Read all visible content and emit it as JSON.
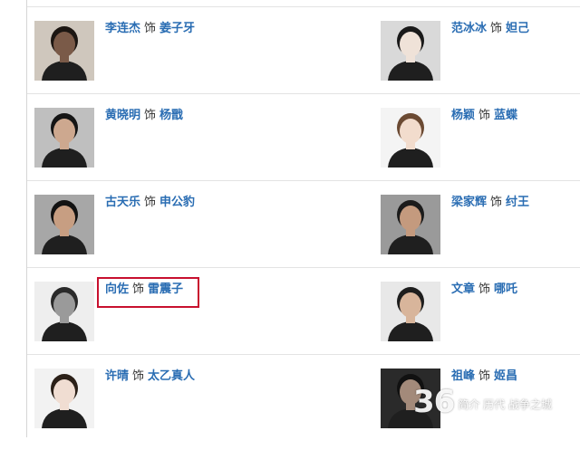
{
  "cast": [
    {
      "actor": "李连杰",
      "as": "饰",
      "role": "姜子牙",
      "tone": "#7a5a48",
      "bg": "#cfc7bd",
      "hair": "#1c1612"
    },
    {
      "actor": "范冰冰",
      "as": "饰",
      "role": "妲己",
      "tone": "#efe2d8",
      "bg": "#d9d9d9",
      "hair": "#1a1a1a"
    },
    {
      "actor": "黄晓明",
      "as": "饰",
      "role": "杨戬",
      "tone": "#cda88f",
      "bg": "#bfbfbf",
      "hair": "#151515"
    },
    {
      "actor": "杨颖",
      "as": "饰",
      "role": "蓝蝶",
      "tone": "#f2dccd",
      "bg": "#f4f4f4",
      "hair": "#6b4a33"
    },
    {
      "actor": "古天乐",
      "as": "饰",
      "role": "申公豹",
      "tone": "#c79e82",
      "bg": "#a7a7a7",
      "hair": "#121212"
    },
    {
      "actor": "梁家辉",
      "as": "饰",
      "role": "纣王",
      "tone": "#c49a7e",
      "bg": "#9a9a9a",
      "hair": "#1b1b1b"
    },
    {
      "actor": "向佐",
      "as": "饰",
      "role": "雷震子",
      "tone": "#9a9a9a",
      "bg": "#eeeeee",
      "hair": "#2a2a2a"
    },
    {
      "actor": "文章",
      "as": "饰",
      "role": "哪吒",
      "tone": "#d8b59b",
      "bg": "#e8e8e8",
      "hair": "#1e1e1e"
    },
    {
      "actor": "许晴",
      "as": "饰",
      "role": "太乙真人",
      "tone": "#f0ddd2",
      "bg": "#f2f2f2",
      "hair": "#2b2018"
    },
    {
      "actor": "祖峰",
      "as": "饰",
      "role": "姬昌",
      "tone": "#a38a7a",
      "bg": "#2a2a2a",
      "hair": "#111111"
    }
  ],
  "watermark": {
    "number": "36",
    "text": "简介 历代 战争之城"
  },
  "colors": {
    "link": "#2a6db3",
    "highlight": "#c8102e"
  }
}
